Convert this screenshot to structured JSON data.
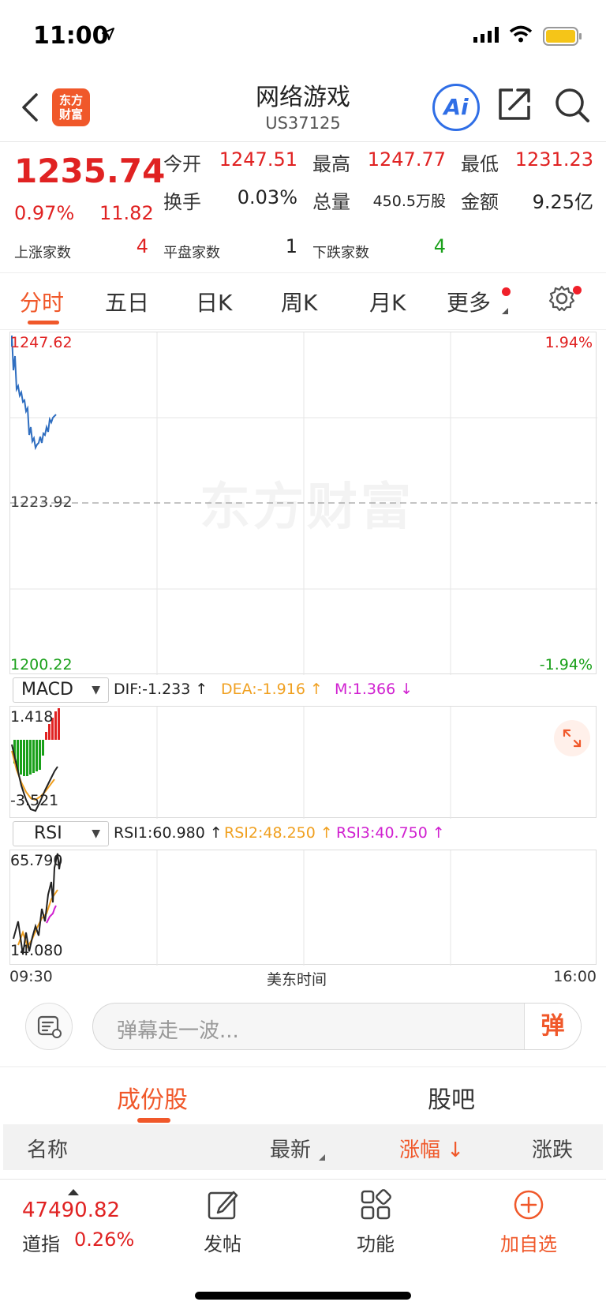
{
  "status": {
    "time": "11:00"
  },
  "nav": {
    "logo_line1": "东方",
    "logo_line2": "财富",
    "title": "网络游戏",
    "code": "US37125",
    "ai_label": "Ai"
  },
  "quote": {
    "price": "1235.74",
    "change_pct": "0.97%",
    "change": "11.82",
    "open_label": "今开",
    "open": "1247.51",
    "high_label": "最高",
    "high": "1247.77",
    "low_label": "最低",
    "low": "1231.23",
    "turnover_label": "换手",
    "turnover": "0.03%",
    "volume_label": "总量",
    "volume": "450.5万股",
    "amount_label": "金额",
    "amount": "9.25亿",
    "up_label": "上涨家数",
    "up_count": "4",
    "flat_label": "平盘家数",
    "flat_count": "1",
    "down_label": "下跌家数",
    "down_count": "4"
  },
  "tabs": [
    "分时",
    "五日",
    "日K",
    "周K",
    "月K",
    "更多"
  ],
  "chart": {
    "top_price": "1247.62",
    "mid_price": "1223.92",
    "bottom_price": "1200.22",
    "top_pct": "1.94%",
    "bottom_pct": "-1.94%",
    "watermark": "东方财富",
    "time_start": "09:30",
    "time_mid": "美东时间",
    "time_end": "16:00",
    "colors": {
      "line": "#2f6ec0",
      "up": "#e02222",
      "down": "#1aa01a"
    }
  },
  "macd": {
    "select": "MACD",
    "dif": "DIF:-1.233 ↑",
    "dea": "DEA:-1.916 ↑",
    "m": "M:1.366 ↓",
    "top": "1.418",
    "bottom": "-3.521"
  },
  "rsi": {
    "select": "RSI",
    "rsi1": "RSI1:60.980 ↑",
    "rsi2": "RSI2:48.250 ↑",
    "rsi3": "RSI3:40.750 ↑",
    "top": "65.790",
    "bottom": "14.080"
  },
  "danmu": {
    "placeholder": "弹幕走一波...",
    "send": "弹"
  },
  "sections": {
    "tab1": "成份股",
    "tab2": "股吧"
  },
  "table": {
    "col_name": "名称",
    "col_latest": "最新",
    "col_pct": "涨幅",
    "col_change": "涨跌"
  },
  "bottom": {
    "index_value": "47490.82",
    "index_name": "道指",
    "index_pct": "0.26%",
    "post": "发帖",
    "func": "功能",
    "add": "加自选"
  }
}
